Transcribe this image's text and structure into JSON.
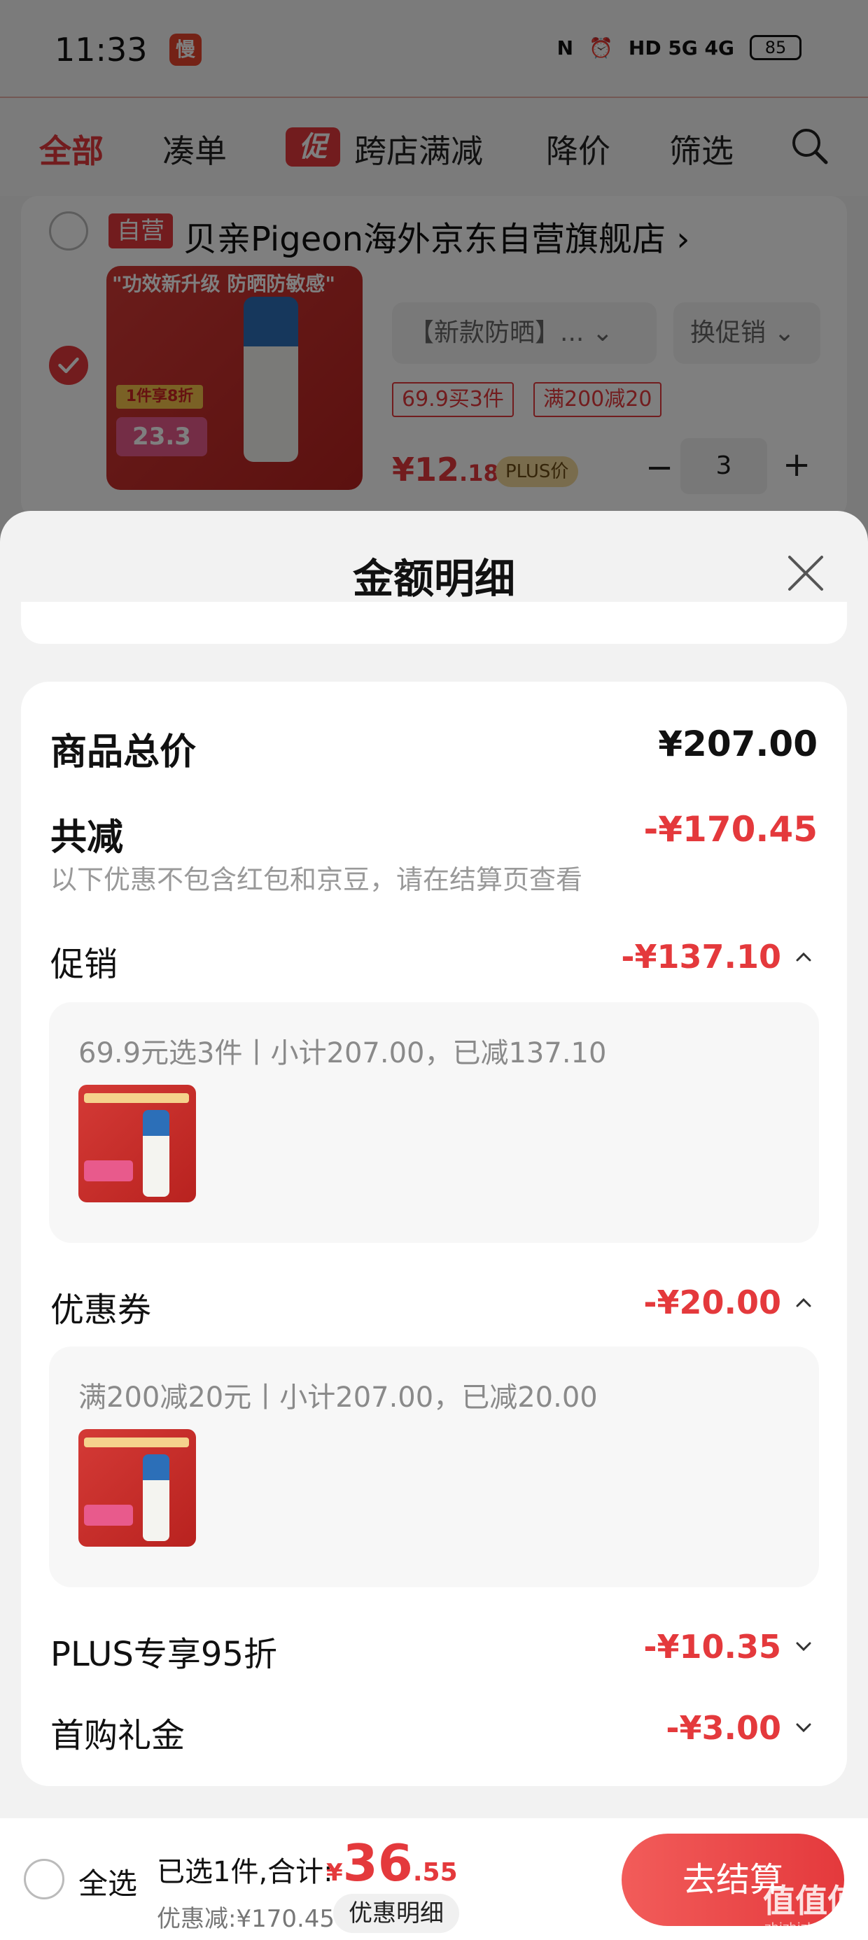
{
  "status_bar": {
    "time": "11:33",
    "app_icon_glyph": "慢",
    "network_text": "HD 5G 4G",
    "battery": "85"
  },
  "tabs": [
    {
      "label": "全部",
      "active": true
    },
    {
      "label": "凑单",
      "active": false
    },
    {
      "label": "跨店满减",
      "active": false,
      "badge": "促"
    },
    {
      "label": "降价",
      "active": false
    },
    {
      "label": "筛选",
      "active": false
    }
  ],
  "shop": {
    "self_badge": "自营",
    "name": "贝亲Pigeon海外京东自营旗舰店",
    "name_arrow": "›"
  },
  "product": {
    "image_headline": "\"功效新升级 防晒防敏感\"",
    "image_tag": "1件享8折",
    "image_price": "23.3",
    "spec": "【新款防晒】...",
    "swap_promo": "换促销",
    "promo_tags": [
      "69.9买3件",
      "满200减20"
    ],
    "price_symbol": "¥",
    "price_int": "12",
    "price_dec": ".18",
    "plus_label": "PLUS价",
    "qty_minus": "−",
    "qty": "3",
    "qty_plus": "+"
  },
  "sheet": {
    "title": "金额明细",
    "total_label": "商品总价",
    "total_amount": "¥207.00",
    "reduce_label": "共减",
    "reduce_amount": "-¥170.45",
    "reduce_note": "以下优惠不包含红包和京豆，请在结算页查看",
    "promo_label": "促销",
    "promo_amount": "-¥137.10",
    "promo_detail": "69.9元选3件丨小计207.00，已减137.10",
    "coupon_label": "优惠券",
    "coupon_amount": "-¥20.00",
    "coupon_detail": "满200减20元丨小计207.00，已减20.00",
    "plus_label": "PLUS专享95折",
    "plus_amount": "-¥10.35",
    "first_label": "首购礼金",
    "first_amount": "-¥3.00"
  },
  "bottom_bar": {
    "select_all": "全选",
    "selected_text": "已选1件,合计:",
    "total_symbol": "¥",
    "total_int": "36",
    "total_dec": ".55",
    "discount_text": "优惠减:¥170.45",
    "detail_chip": "优惠明细",
    "checkout": "去结算"
  },
  "watermark": {
    "text": "值值值",
    "sub": "zhizhizhi.com"
  },
  "colors": {
    "accent_red": "#e4393c",
    "plus_gold": "#f3d99a"
  }
}
